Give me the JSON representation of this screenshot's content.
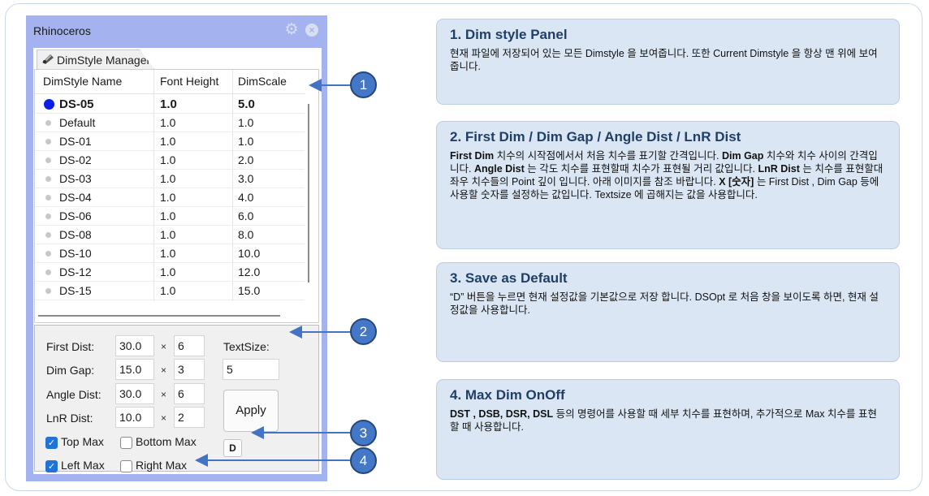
{
  "window": {
    "title": "Rhinoceros"
  },
  "tab": {
    "label": "DimStyle Manager"
  },
  "table": {
    "headers": [
      "DimStyle Name",
      "Font Height",
      "DimScale"
    ],
    "rows": [
      {
        "name": "DS-05",
        "font_height": "1.0",
        "dimscale": "5.0",
        "current": true
      },
      {
        "name": "Default",
        "font_height": "1.0",
        "dimscale": "1.0"
      },
      {
        "name": "DS-01",
        "font_height": "1.0",
        "dimscale": "1.0"
      },
      {
        "name": "DS-02",
        "font_height": "1.0",
        "dimscale": "2.0"
      },
      {
        "name": "DS-03",
        "font_height": "1.0",
        "dimscale": "3.0"
      },
      {
        "name": "DS-04",
        "font_height": "1.0",
        "dimscale": "4.0"
      },
      {
        "name": "DS-06",
        "font_height": "1.0",
        "dimscale": "6.0"
      },
      {
        "name": "DS-08",
        "font_height": "1.0",
        "dimscale": "8.0"
      },
      {
        "name": "DS-10",
        "font_height": "1.0",
        "dimscale": "10.0"
      },
      {
        "name": "DS-12",
        "font_height": "1.0",
        "dimscale": "12.0"
      },
      {
        "name": "DS-15",
        "font_height": "1.0",
        "dimscale": "15.0"
      }
    ]
  },
  "settings": {
    "first_dist": {
      "label": "First Dist:",
      "value": "30.0",
      "mult": "6"
    },
    "dim_gap": {
      "label": "Dim Gap:",
      "value": "15.0",
      "mult": "3"
    },
    "angle_dist": {
      "label": "Angle Dist:",
      "value": "30.0",
      "mult": "6"
    },
    "lnr_dist": {
      "label": "LnR Dist:",
      "value": "10.0",
      "mult": "2"
    },
    "times_symbol": "×",
    "textsize": {
      "label": "TextSize:",
      "value": "5"
    },
    "apply_label": "Apply",
    "d_label": "D",
    "checkboxes": {
      "top_max": {
        "label": "Top Max",
        "checked": true
      },
      "bottom_max": {
        "label": "Bottom Max",
        "checked": false
      },
      "left_max": {
        "label": "Left Max",
        "checked": true
      },
      "right_max": {
        "label": "Right Max",
        "checked": false
      }
    }
  },
  "callouts": [
    "1",
    "2",
    "3",
    "4"
  ],
  "cards": [
    {
      "title": "1. Dim style Panel",
      "body": "현재 파일에 저장되어 있는 모든 Dimstyle 을 보여줍니다. 또한 Current Dimstyle 을 항상 맨 위에 보여줍니다."
    },
    {
      "title": "2. First Dim / Dim Gap / Angle Dist / LnR Dist",
      "b1": "First Dim",
      "t1": " 치수의 시작점에서서 처음 치수를 표기할 간격입니다. ",
      "b2": "Dim Gap",
      "t2": " 치수와 치수 사이의 간격입니다.  ",
      "b3": "Angle Dist",
      "t3": " 는 각도 치수를 표현할때 치수가 표현될 거리 값입니다. ",
      "b4": "LnR Dist",
      "t4": " 는 치수를 표현할대 좌우 치수들의 Point 깊이 입니다.  아래 이미지를 참조 바랍니다.  ",
      "b5": "X [숫자]",
      "t5": " 는 First Dist , Dim Gap 등에 사용할 숫자를 설정하는 값입니다. Textsize 에 곱해지는 값을 사용합니다."
    },
    {
      "title": "3. Save as Default",
      "body": "“D” 버튼을 누르면 현재 설정값을 기본값으로 저장 합니다. DSOpt 로 처음 창을 보이도록 하면, 현재 설정값을 사용합니다."
    },
    {
      "title": "4. Max Dim OnOff",
      "b1": "DST , DSB, DSR, DSL",
      "t1": "  등의 명령어를 사용할 때 세부 치수를 표현하며, 추가적으로 Max 치수를 표현할 때 사용합니다."
    }
  ]
}
